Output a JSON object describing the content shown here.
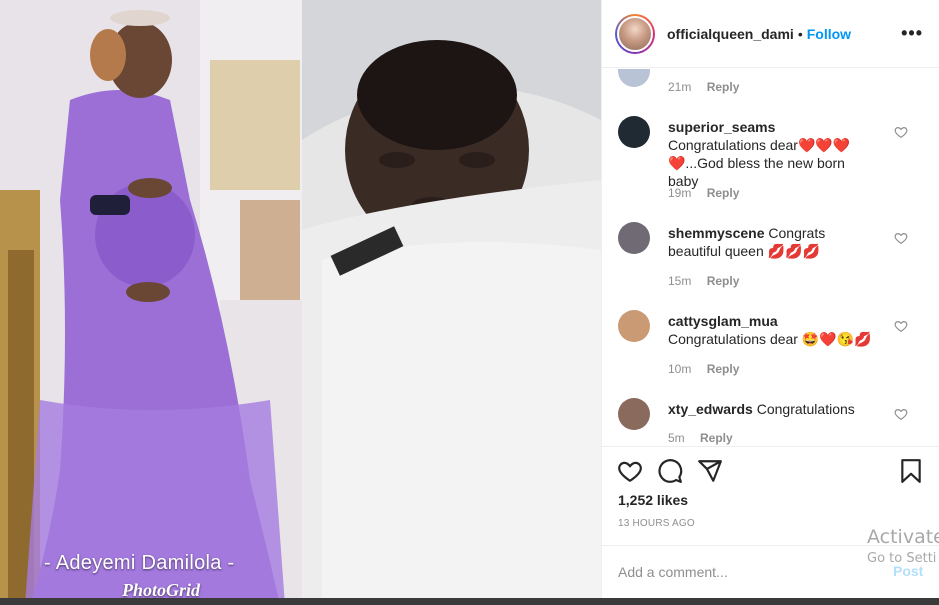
{
  "media": {
    "watermark_name": "- Adeyemi Damilola -",
    "watermark_app": "PhotoGrid"
  },
  "header": {
    "username": "officialqueen_dami",
    "separator": "•",
    "follow_label": "Follow",
    "more_icon": "more-options-icon",
    "more_glyph": "•••"
  },
  "comments": [
    {
      "user": "",
      "text": "",
      "time": "21m",
      "reply_label": "Reply",
      "avatar_color": "#b9c3d6"
    },
    {
      "user": "superior_seams",
      "text": "Congratulations dear❤️❤️❤️❤️...God bless the new born baby",
      "time": "19m",
      "reply_label": "Reply",
      "avatar_color": "#1f2a33"
    },
    {
      "user": "shemmyscene",
      "text": "Congrats beautiful queen 💋💋💋",
      "time": "15m",
      "reply_label": "Reply",
      "avatar_color": "#6f6a73"
    },
    {
      "user": "cattysglam_mua",
      "text": "Congratulations dear 🤩❤️😘💋",
      "time": "10m",
      "reply_label": "Reply",
      "avatar_color": "#c99a74"
    },
    {
      "user": "xty_edwards",
      "text": "Congratulations",
      "time": "5m",
      "reply_label": "Reply",
      "avatar_color": "#8a6a5c"
    }
  ],
  "actions": {
    "like_icon": "heart-icon",
    "comment_icon": "comment-icon",
    "share_icon": "share-icon",
    "save_icon": "bookmark-icon",
    "likes_text": "1,252 likes",
    "time_text": "13 HOURS AGO"
  },
  "add_comment": {
    "placeholder": "Add a comment...",
    "post_label": "Post"
  },
  "os_overlay": {
    "line1": "Activate",
    "line2": "Go to Setti"
  },
  "colors": {
    "accent": "#0095f6",
    "post_disabled": "#b2dffc",
    "muted": "#8e8e8e",
    "gown": "#9b6fd6"
  }
}
